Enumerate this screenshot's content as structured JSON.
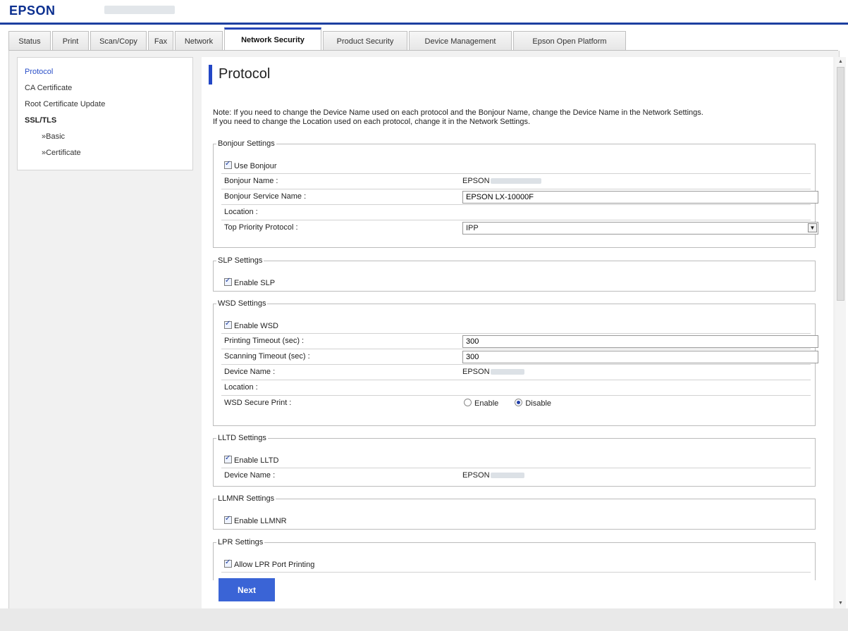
{
  "header": {
    "brand": "EPSON"
  },
  "tabs": [
    {
      "label": "Status"
    },
    {
      "label": "Print"
    },
    {
      "label": "Scan/Copy"
    },
    {
      "label": "Fax"
    },
    {
      "label": "Network"
    },
    {
      "label": "Network Security"
    },
    {
      "label": "Product Security"
    },
    {
      "label": "Device Management"
    },
    {
      "label": "Epson Open Platform"
    }
  ],
  "sidebar": {
    "items": [
      {
        "label": "Protocol"
      },
      {
        "label": "CA Certificate"
      },
      {
        "label": "Root Certificate Update"
      },
      {
        "label": "SSL/TLS"
      },
      {
        "label": "»Basic"
      },
      {
        "label": "»Certificate"
      }
    ]
  },
  "main": {
    "title": "Protocol",
    "note_line1": "Note: If you need to change the Device Name used on each protocol and the Bonjour Name, change the Device Name in the Network Settings.",
    "note_line2": "If you need to change the Location used on each protocol, change it in the Network Settings.",
    "bonjour": {
      "legend": "Bonjour Settings",
      "use_label": "Use Bonjour",
      "name_label": "Bonjour Name :",
      "name_value": "EPSON",
      "service_label": "Bonjour Service Name :",
      "service_value": "EPSON LX-10000F",
      "location_label": "Location :",
      "priority_label": "Top Priority Protocol :",
      "priority_value": "IPP"
    },
    "slp": {
      "legend": "SLP Settings",
      "enable_label": "Enable SLP"
    },
    "wsd": {
      "legend": "WSD Settings",
      "enable_label": "Enable WSD",
      "print_timeout_label": "Printing Timeout (sec) :",
      "print_timeout_value": "300",
      "scan_timeout_label": "Scanning Timeout (sec) :",
      "scan_timeout_value": "300",
      "device_name_label": "Device Name :",
      "device_name_value": "EPSON",
      "location_label": "Location :",
      "secure_print_label": "WSD Secure Print :",
      "enable_option": "Enable",
      "disable_option": "Disable"
    },
    "lltd": {
      "legend": "LLTD Settings",
      "enable_label": "Enable LLTD",
      "device_name_label": "Device Name :",
      "device_name_value": "EPSON"
    },
    "llmnr": {
      "legend": "LLMNR Settings",
      "enable_label": "Enable LLMNR"
    },
    "lpr": {
      "legend": "LPR Settings",
      "allow_label": "Allow LPR Port Printing"
    },
    "next_button": "Next"
  },
  "colors": {
    "accent": "#2347c6",
    "brand": "#0b2f8f",
    "button": "#3a64d6"
  }
}
